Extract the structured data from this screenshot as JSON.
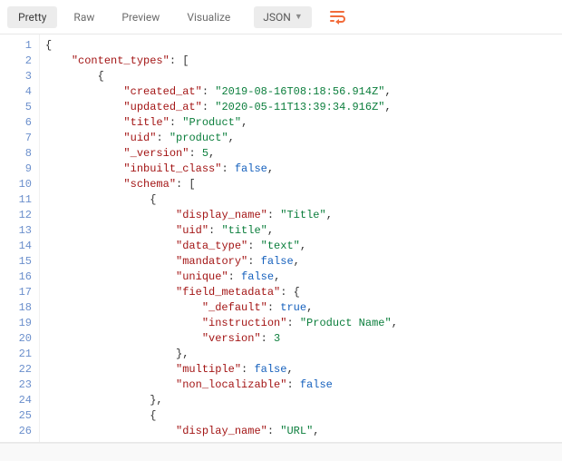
{
  "toolbar": {
    "tabs": {
      "pretty": "Pretty",
      "raw": "Raw",
      "preview": "Preview",
      "visualize": "Visualize"
    },
    "format_label": "JSON"
  },
  "json_text_lines": [
    [
      [
        "br",
        "{"
      ]
    ],
    [
      [
        "p",
        "    "
      ],
      [
        "k",
        "\"content_types\""
      ],
      [
        "p",
        ": ["
      ]
    ],
    [
      [
        "p",
        "        "
      ],
      [
        "br",
        "{"
      ]
    ],
    [
      [
        "p",
        "            "
      ],
      [
        "k",
        "\"created_at\""
      ],
      [
        "p",
        ": "
      ],
      [
        "s",
        "\"2019-08-16T08:18:56.914Z\""
      ],
      [
        "p",
        ","
      ]
    ],
    [
      [
        "p",
        "            "
      ],
      [
        "k",
        "\"updated_at\""
      ],
      [
        "p",
        ": "
      ],
      [
        "s",
        "\"2020-05-11T13:39:34.916Z\""
      ],
      [
        "p",
        ","
      ]
    ],
    [
      [
        "p",
        "            "
      ],
      [
        "k",
        "\"title\""
      ],
      [
        "p",
        ": "
      ],
      [
        "s",
        "\"Product\""
      ],
      [
        "p",
        ","
      ]
    ],
    [
      [
        "p",
        "            "
      ],
      [
        "k",
        "\"uid\""
      ],
      [
        "p",
        ": "
      ],
      [
        "s",
        "\"product\""
      ],
      [
        "p",
        ","
      ]
    ],
    [
      [
        "p",
        "            "
      ],
      [
        "k",
        "\"_version\""
      ],
      [
        "p",
        ": "
      ],
      [
        "n",
        "5"
      ],
      [
        "p",
        ","
      ]
    ],
    [
      [
        "p",
        "            "
      ],
      [
        "k",
        "\"inbuilt_class\""
      ],
      [
        "p",
        ": "
      ],
      [
        "b",
        "false"
      ],
      [
        "p",
        ","
      ]
    ],
    [
      [
        "p",
        "            "
      ],
      [
        "k",
        "\"schema\""
      ],
      [
        "p",
        ": ["
      ]
    ],
    [
      [
        "p",
        "                "
      ],
      [
        "br",
        "{"
      ]
    ],
    [
      [
        "p",
        "                    "
      ],
      [
        "k",
        "\"display_name\""
      ],
      [
        "p",
        ": "
      ],
      [
        "s",
        "\"Title\""
      ],
      [
        "p",
        ","
      ]
    ],
    [
      [
        "p",
        "                    "
      ],
      [
        "k",
        "\"uid\""
      ],
      [
        "p",
        ": "
      ],
      [
        "s",
        "\"title\""
      ],
      [
        "p",
        ","
      ]
    ],
    [
      [
        "p",
        "                    "
      ],
      [
        "k",
        "\"data_type\""
      ],
      [
        "p",
        ": "
      ],
      [
        "s",
        "\"text\""
      ],
      [
        "p",
        ","
      ]
    ],
    [
      [
        "p",
        "                    "
      ],
      [
        "k",
        "\"mandatory\""
      ],
      [
        "p",
        ": "
      ],
      [
        "b",
        "false"
      ],
      [
        "p",
        ","
      ]
    ],
    [
      [
        "p",
        "                    "
      ],
      [
        "k",
        "\"unique\""
      ],
      [
        "p",
        ": "
      ],
      [
        "b",
        "false"
      ],
      [
        "p",
        ","
      ]
    ],
    [
      [
        "p",
        "                    "
      ],
      [
        "k",
        "\"field_metadata\""
      ],
      [
        "p",
        ": "
      ],
      [
        "br",
        "{"
      ]
    ],
    [
      [
        "p",
        "                        "
      ],
      [
        "k",
        "\"_default\""
      ],
      [
        "p",
        ": "
      ],
      [
        "b",
        "true"
      ],
      [
        "p",
        ","
      ]
    ],
    [
      [
        "p",
        "                        "
      ],
      [
        "k",
        "\"instruction\""
      ],
      [
        "p",
        ": "
      ],
      [
        "s",
        "\"Product Name\""
      ],
      [
        "p",
        ","
      ]
    ],
    [
      [
        "p",
        "                        "
      ],
      [
        "k",
        "\"version\""
      ],
      [
        "p",
        ": "
      ],
      [
        "n",
        "3"
      ]
    ],
    [
      [
        "p",
        "                    "
      ],
      [
        "br",
        "}"
      ],
      [
        "p",
        ","
      ]
    ],
    [
      [
        "p",
        "                    "
      ],
      [
        "k",
        "\"multiple\""
      ],
      [
        "p",
        ": "
      ],
      [
        "b",
        "false"
      ],
      [
        "p",
        ","
      ]
    ],
    [
      [
        "p",
        "                    "
      ],
      [
        "k",
        "\"non_localizable\""
      ],
      [
        "p",
        ": "
      ],
      [
        "b",
        "false"
      ]
    ],
    [
      [
        "p",
        "                "
      ],
      [
        "br",
        "}"
      ],
      [
        "p",
        ","
      ]
    ],
    [
      [
        "p",
        "                "
      ],
      [
        "br",
        "{"
      ]
    ],
    [
      [
        "p",
        "                    "
      ],
      [
        "k",
        "\"display_name\""
      ],
      [
        "p",
        ": "
      ],
      [
        "s",
        "\"URL\""
      ],
      [
        "p",
        ","
      ]
    ]
  ],
  "chart_data": {
    "type": "table",
    "title": "API response JSON body",
    "schema_object": {
      "content_types": [
        {
          "created_at": "2019-08-16T08:18:56.914Z",
          "updated_at": "2020-05-11T13:39:34.916Z",
          "title": "Product",
          "uid": "product",
          "_version": 5,
          "inbuilt_class": false,
          "schema": [
            {
              "display_name": "Title",
              "uid": "title",
              "data_type": "text",
              "mandatory": false,
              "unique": false,
              "field_metadata": {
                "_default": true,
                "instruction": "Product Name",
                "version": 3
              },
              "multiple": false,
              "non_localizable": false
            },
            {
              "display_name": "URL"
            }
          ]
        }
      ]
    }
  }
}
